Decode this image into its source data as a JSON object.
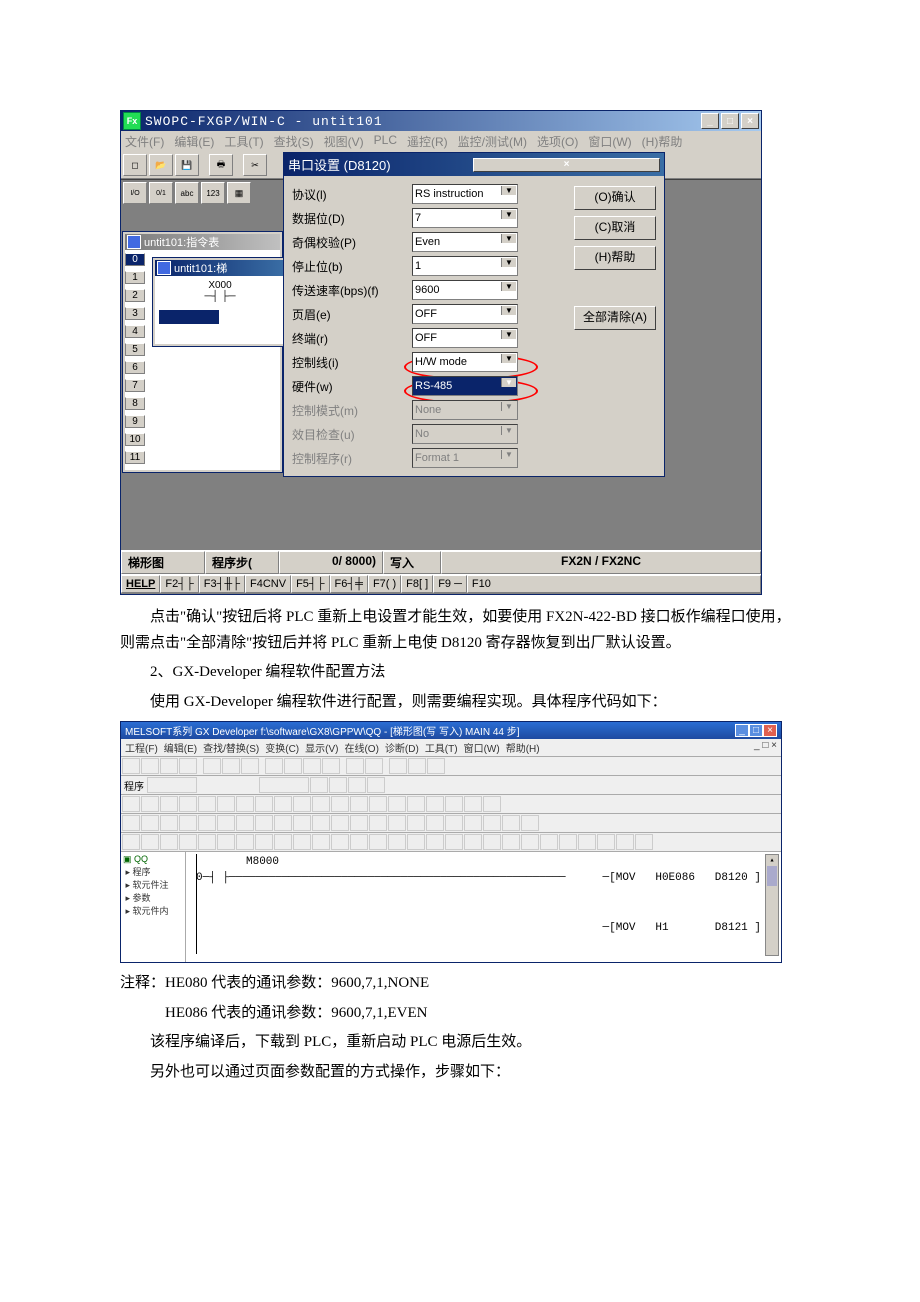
{
  "app1": {
    "title": "SWOPC-FXGP/WIN-C - untit101",
    "menus": [
      "文件(F)",
      "编辑(E)",
      "工具(T)",
      "查找(S)",
      "视图(V)",
      "PLC",
      "遥控(R)",
      "监控/测试(M)",
      "选项(O)",
      "窗口(W)",
      "(H)帮助"
    ],
    "toolbar_icons": [
      "new",
      "open",
      "save",
      "print",
      "cut"
    ],
    "toolbar2_icons": [
      "I/O",
      "0/1",
      "abc",
      "123",
      "grid"
    ],
    "mdi_instr_title": "untit101:指令表",
    "mdi_ladder_title": "untit101:梯",
    "ladder_rows": [
      "0",
      "1",
      "2",
      "3",
      "4",
      "5",
      "6",
      "7",
      "8",
      "9",
      "10",
      "11"
    ],
    "ladder_x": "X000",
    "status": {
      "mode": "梯形图",
      "step": "程序步(",
      "step_val": "0/ 8000)",
      "write": "写入",
      "model": "FX2N / FX2NC"
    },
    "fn": [
      "HELP",
      "F2┤├",
      "F3┤╫├",
      "F4CNV",
      "F5┤├",
      "F6┤╪",
      "F7( )",
      "F8[ ]",
      "F9 ─",
      "F10"
    ]
  },
  "dialog": {
    "title": "串口设置 (D8120)",
    "rows": [
      {
        "label": "协议(l)",
        "value": "RS instruction"
      },
      {
        "label": "数据位(D)",
        "value": "7"
      },
      {
        "label": "奇偶校验(P)",
        "value": "Even"
      },
      {
        "label": "停止位(b)",
        "value": "1"
      },
      {
        "label": "传送速率(bps)(f)",
        "value": "9600"
      },
      {
        "label": "页眉(e)",
        "value": "OFF"
      },
      {
        "label": "终端(r)",
        "value": "OFF"
      },
      {
        "label": "控制线(i)",
        "value": "H/W mode",
        "ring": true
      },
      {
        "label": "硬件(w)",
        "value": "RS-485",
        "ring": true,
        "hl": true
      },
      {
        "label": "控制模式(m)",
        "value": "None",
        "disabled": true
      },
      {
        "label": "效目检查(u)",
        "value": "No",
        "disabled": true
      },
      {
        "label": "控制程序(r)",
        "value": "Format 1",
        "disabled": true
      }
    ],
    "buttons": [
      "(O)确认",
      "(C)取消",
      "(H)帮助",
      "全部清除(A)"
    ]
  },
  "para1": "点击\"确认\"按钮后将 PLC 重新上电设置才能生效，如要使用 FX2N-422-BD 接口板作编程口使用，则需点击\"全部清除\"按钮后并将 PLC 重新上电使 D8120 寄存器恢复到出厂默认设置。",
  "para2": "2、GX-Developer 编程软件配置方法",
  "para3": "使用 GX-Developer 编程软件进行配置，则需要编程实现。具体程序代码如下：",
  "app2": {
    "title": "MELSOFT系列 GX Developer f:\\software\\GX8\\GPPW\\QQ - [梯形图(写 写入)    MAIN    44 步]",
    "menus": [
      "工程(F)",
      "编辑(E)",
      "查找/替换(S)",
      "变换(C)",
      "显示(V)",
      "在线(O)",
      "诊断(D)",
      "工具(T)",
      "窗口(W)",
      "帮助(H)"
    ],
    "tree": [
      "QQ",
      "程序",
      "软元件注",
      "参数",
      "软元件内"
    ],
    "ladder_contact": "M8000",
    "rung1": {
      "op": "MOV",
      "s": "H0E086",
      "d": "D8120"
    },
    "rung2": {
      "op": "MOV",
      "s": "H1",
      "d": "D8121"
    }
  },
  "note1_label": "注释：",
  "note1": "HE080 代表的通讯参数：9600,7,1,NONE",
  "note2": "HE086 代表的通讯参数：9600,7,1,EVEN",
  "para4": "该程序编译后，下载到 PLC，重新启动 PLC 电源后生效。",
  "para5": "另外也可以通过页面参数配置的方式操作，步骤如下："
}
